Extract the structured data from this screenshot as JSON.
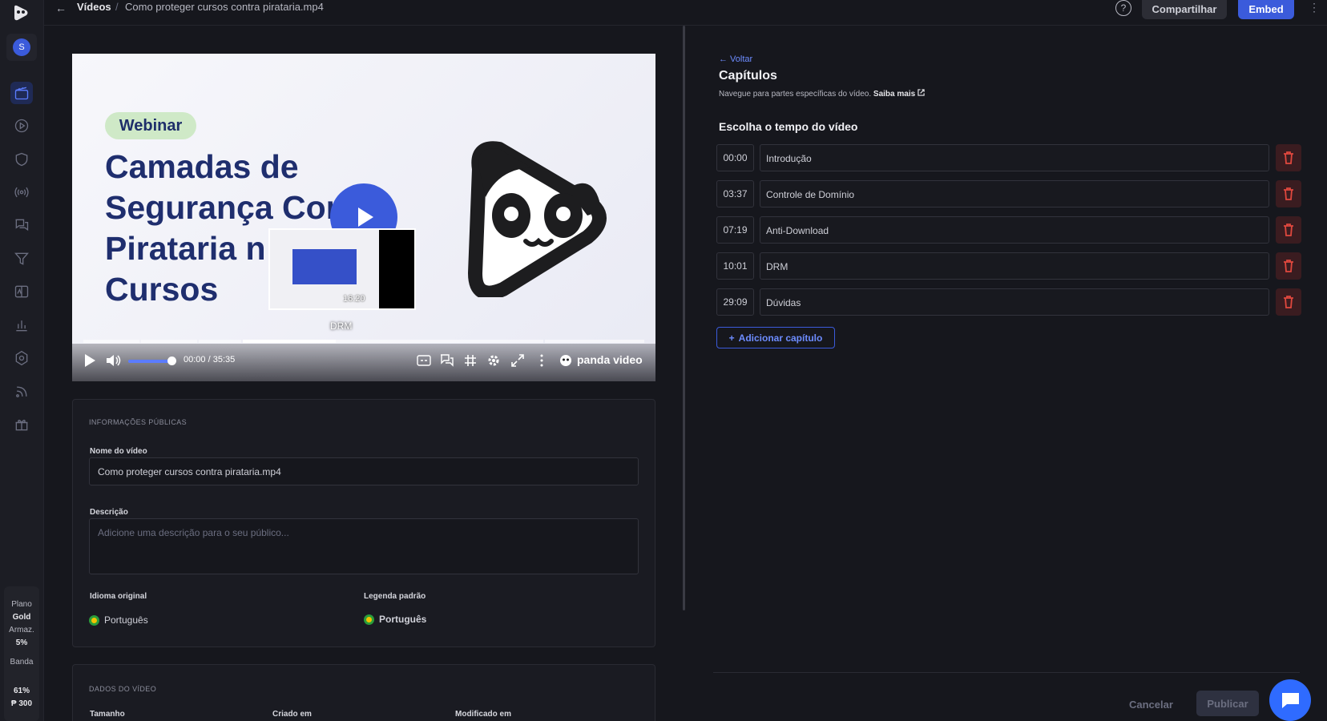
{
  "breadcrumb": {
    "section": "Vídeos",
    "separator": "/",
    "file": "Como proteger cursos contra pirataria.mp4"
  },
  "topbar": {
    "share_label": "Compartilhar",
    "embed_label": "Embed",
    "help_glyph": "?",
    "kebab_glyph": "⋮",
    "back_glyph": "←"
  },
  "sidebar": {
    "avatar_initial": "S",
    "items": [
      {
        "icon": "video-library-icon",
        "active": true
      },
      {
        "icon": "play-circle-icon",
        "active": false
      },
      {
        "icon": "shield-icon",
        "active": false
      },
      {
        "icon": "live-broadcast-icon",
        "active": false
      },
      {
        "icon": "chat-icon",
        "active": false
      },
      {
        "icon": "filter-icon",
        "active": false
      },
      {
        "icon": "compare-icon",
        "active": false
      },
      {
        "icon": "bar-chart-icon",
        "active": false
      },
      {
        "icon": "settings-icon",
        "active": false
      },
      {
        "icon": "rss-icon",
        "active": false
      },
      {
        "icon": "gift-icon",
        "active": false
      }
    ],
    "plan": {
      "plan_label": "Plano",
      "plan_value": "Gold",
      "storage_label": "Armaz.",
      "storage_value": "5%",
      "bandwidth_label": "Banda",
      "bandwidth_value": "61%",
      "credits": "₱ 300"
    }
  },
  "video": {
    "badge": "Webinar",
    "title_lines": [
      "Camadas de",
      "Segurança Contra",
      "Pirataria n",
      "Cursos"
    ],
    "thumb_time": "16:20",
    "thumb_label": "DRM",
    "current_time": "00:00",
    "time_sep": "/",
    "duration": "35:35",
    "brand": "panda video",
    "volume_fraction": 0.85,
    "played_fraction": 0.0,
    "buffered_fraction": 0.45
  },
  "public_info": {
    "section_title": "INFORMAÇÕES PÚBLICAS",
    "name_label": "Nome do vídeo",
    "name_value": "Como proteger cursos contra pirataria.mp4",
    "description_label": "Descrição",
    "description_placeholder": "Adicione uma descrição para o seu público...",
    "original_language_label": "Idioma original",
    "original_language_value": "Português",
    "default_subtitle_label": "Legenda padrão",
    "default_subtitle_value": "Português"
  },
  "video_data": {
    "section_title": "DADOS DO VÍDEO",
    "size_label": "Tamanho",
    "created_label": "Criado em",
    "modified_label": "Modificado em"
  },
  "chapters_panel": {
    "back_label": "← Voltar",
    "title": "Capítulos",
    "subtitle": "Navegue para partes específicas do vídeo.",
    "learn_more": "Saiba mais",
    "choose_time_label": "Escolha o tempo do vídeo",
    "chapters": [
      {
        "time": "00:00",
        "name": "Introdução"
      },
      {
        "time": "03:37",
        "name": "Controle de Domínio"
      },
      {
        "time": "07:19",
        "name": "Anti-Download"
      },
      {
        "time": "10:01",
        "name": "DRM"
      },
      {
        "time": "29:09",
        "name": "Dúvidas"
      }
    ],
    "add_label": "Adicionar capítulo",
    "cancel_label": "Cancelar",
    "publish_label": "Publicar"
  },
  "colors": {
    "accent": "#3b5bdb",
    "danger": "#e0483e",
    "background": "#16171d"
  }
}
